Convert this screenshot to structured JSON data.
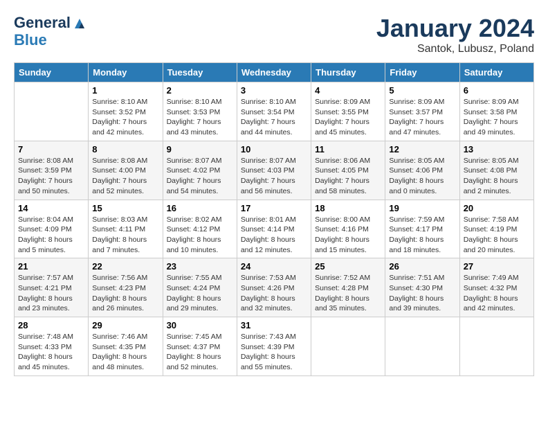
{
  "header": {
    "logo_line1": "General",
    "logo_line2": "Blue",
    "month": "January 2024",
    "location": "Santok, Lubusz, Poland"
  },
  "days_of_week": [
    "Sunday",
    "Monday",
    "Tuesday",
    "Wednesday",
    "Thursday",
    "Friday",
    "Saturday"
  ],
  "weeks": [
    [
      {
        "day": "",
        "info": ""
      },
      {
        "day": "1",
        "info": "Sunrise: 8:10 AM\nSunset: 3:52 PM\nDaylight: 7 hours\nand 42 minutes."
      },
      {
        "day": "2",
        "info": "Sunrise: 8:10 AM\nSunset: 3:53 PM\nDaylight: 7 hours\nand 43 minutes."
      },
      {
        "day": "3",
        "info": "Sunrise: 8:10 AM\nSunset: 3:54 PM\nDaylight: 7 hours\nand 44 minutes."
      },
      {
        "day": "4",
        "info": "Sunrise: 8:09 AM\nSunset: 3:55 PM\nDaylight: 7 hours\nand 45 minutes."
      },
      {
        "day": "5",
        "info": "Sunrise: 8:09 AM\nSunset: 3:57 PM\nDaylight: 7 hours\nand 47 minutes."
      },
      {
        "day": "6",
        "info": "Sunrise: 8:09 AM\nSunset: 3:58 PM\nDaylight: 7 hours\nand 49 minutes."
      }
    ],
    [
      {
        "day": "7",
        "info": "Sunrise: 8:08 AM\nSunset: 3:59 PM\nDaylight: 7 hours\nand 50 minutes."
      },
      {
        "day": "8",
        "info": "Sunrise: 8:08 AM\nSunset: 4:00 PM\nDaylight: 7 hours\nand 52 minutes."
      },
      {
        "day": "9",
        "info": "Sunrise: 8:07 AM\nSunset: 4:02 PM\nDaylight: 7 hours\nand 54 minutes."
      },
      {
        "day": "10",
        "info": "Sunrise: 8:07 AM\nSunset: 4:03 PM\nDaylight: 7 hours\nand 56 minutes."
      },
      {
        "day": "11",
        "info": "Sunrise: 8:06 AM\nSunset: 4:05 PM\nDaylight: 7 hours\nand 58 minutes."
      },
      {
        "day": "12",
        "info": "Sunrise: 8:05 AM\nSunset: 4:06 PM\nDaylight: 8 hours\nand 0 minutes."
      },
      {
        "day": "13",
        "info": "Sunrise: 8:05 AM\nSunset: 4:08 PM\nDaylight: 8 hours\nand 2 minutes."
      }
    ],
    [
      {
        "day": "14",
        "info": "Sunrise: 8:04 AM\nSunset: 4:09 PM\nDaylight: 8 hours\nand 5 minutes."
      },
      {
        "day": "15",
        "info": "Sunrise: 8:03 AM\nSunset: 4:11 PM\nDaylight: 8 hours\nand 7 minutes."
      },
      {
        "day": "16",
        "info": "Sunrise: 8:02 AM\nSunset: 4:12 PM\nDaylight: 8 hours\nand 10 minutes."
      },
      {
        "day": "17",
        "info": "Sunrise: 8:01 AM\nSunset: 4:14 PM\nDaylight: 8 hours\nand 12 minutes."
      },
      {
        "day": "18",
        "info": "Sunrise: 8:00 AM\nSunset: 4:16 PM\nDaylight: 8 hours\nand 15 minutes."
      },
      {
        "day": "19",
        "info": "Sunrise: 7:59 AM\nSunset: 4:17 PM\nDaylight: 8 hours\nand 18 minutes."
      },
      {
        "day": "20",
        "info": "Sunrise: 7:58 AM\nSunset: 4:19 PM\nDaylight: 8 hours\nand 20 minutes."
      }
    ],
    [
      {
        "day": "21",
        "info": "Sunrise: 7:57 AM\nSunset: 4:21 PM\nDaylight: 8 hours\nand 23 minutes."
      },
      {
        "day": "22",
        "info": "Sunrise: 7:56 AM\nSunset: 4:23 PM\nDaylight: 8 hours\nand 26 minutes."
      },
      {
        "day": "23",
        "info": "Sunrise: 7:55 AM\nSunset: 4:24 PM\nDaylight: 8 hours\nand 29 minutes."
      },
      {
        "day": "24",
        "info": "Sunrise: 7:53 AM\nSunset: 4:26 PM\nDaylight: 8 hours\nand 32 minutes."
      },
      {
        "day": "25",
        "info": "Sunrise: 7:52 AM\nSunset: 4:28 PM\nDaylight: 8 hours\nand 35 minutes."
      },
      {
        "day": "26",
        "info": "Sunrise: 7:51 AM\nSunset: 4:30 PM\nDaylight: 8 hours\nand 39 minutes."
      },
      {
        "day": "27",
        "info": "Sunrise: 7:49 AM\nSunset: 4:32 PM\nDaylight: 8 hours\nand 42 minutes."
      }
    ],
    [
      {
        "day": "28",
        "info": "Sunrise: 7:48 AM\nSunset: 4:33 PM\nDaylight: 8 hours\nand 45 minutes."
      },
      {
        "day": "29",
        "info": "Sunrise: 7:46 AM\nSunset: 4:35 PM\nDaylight: 8 hours\nand 48 minutes."
      },
      {
        "day": "30",
        "info": "Sunrise: 7:45 AM\nSunset: 4:37 PM\nDaylight: 8 hours\nand 52 minutes."
      },
      {
        "day": "31",
        "info": "Sunrise: 7:43 AM\nSunset: 4:39 PM\nDaylight: 8 hours\nand 55 minutes."
      },
      {
        "day": "",
        "info": ""
      },
      {
        "day": "",
        "info": ""
      },
      {
        "day": "",
        "info": ""
      }
    ]
  ]
}
